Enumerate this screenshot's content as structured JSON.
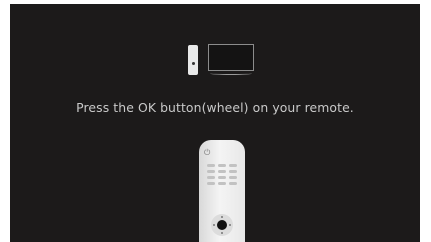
{
  "screen": {
    "instruction_text": "Press the OK button(wheel) on your remote."
  },
  "icons": {
    "pairing": "remote-and-tv-icon",
    "remote": "magic-remote-icon",
    "power": "power-icon",
    "ok_wheel": "ok-wheel-icon"
  },
  "colors": {
    "background": "#1c1a1a",
    "text": "#c9c9c9",
    "remote_body": "#eeeeee"
  }
}
